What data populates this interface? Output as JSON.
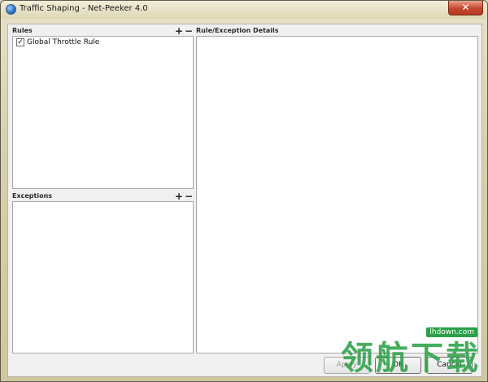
{
  "window": {
    "title": "Traffic Shaping - Net-Peeker 4.0",
    "close_glyph": "✕"
  },
  "rules": {
    "label": "Rules",
    "add_glyph": "+",
    "remove_glyph": "−",
    "items": [
      {
        "label": "Global Throttle Rule",
        "checked": true,
        "check_glyph": "✓"
      }
    ]
  },
  "exceptions": {
    "label": "Exceptions",
    "add_glyph": "+",
    "remove_glyph": "−"
  },
  "details": {
    "label": "Rule/Exception Details"
  },
  "buttons": {
    "apply": "Apply",
    "ok": "OK",
    "cancel": "Cancel"
  },
  "watermark": {
    "url": "lhdown.com",
    "text": "领航下载"
  },
  "colors": {
    "watermark_green": "#2ba04a",
    "close_red": "#c5482e"
  }
}
